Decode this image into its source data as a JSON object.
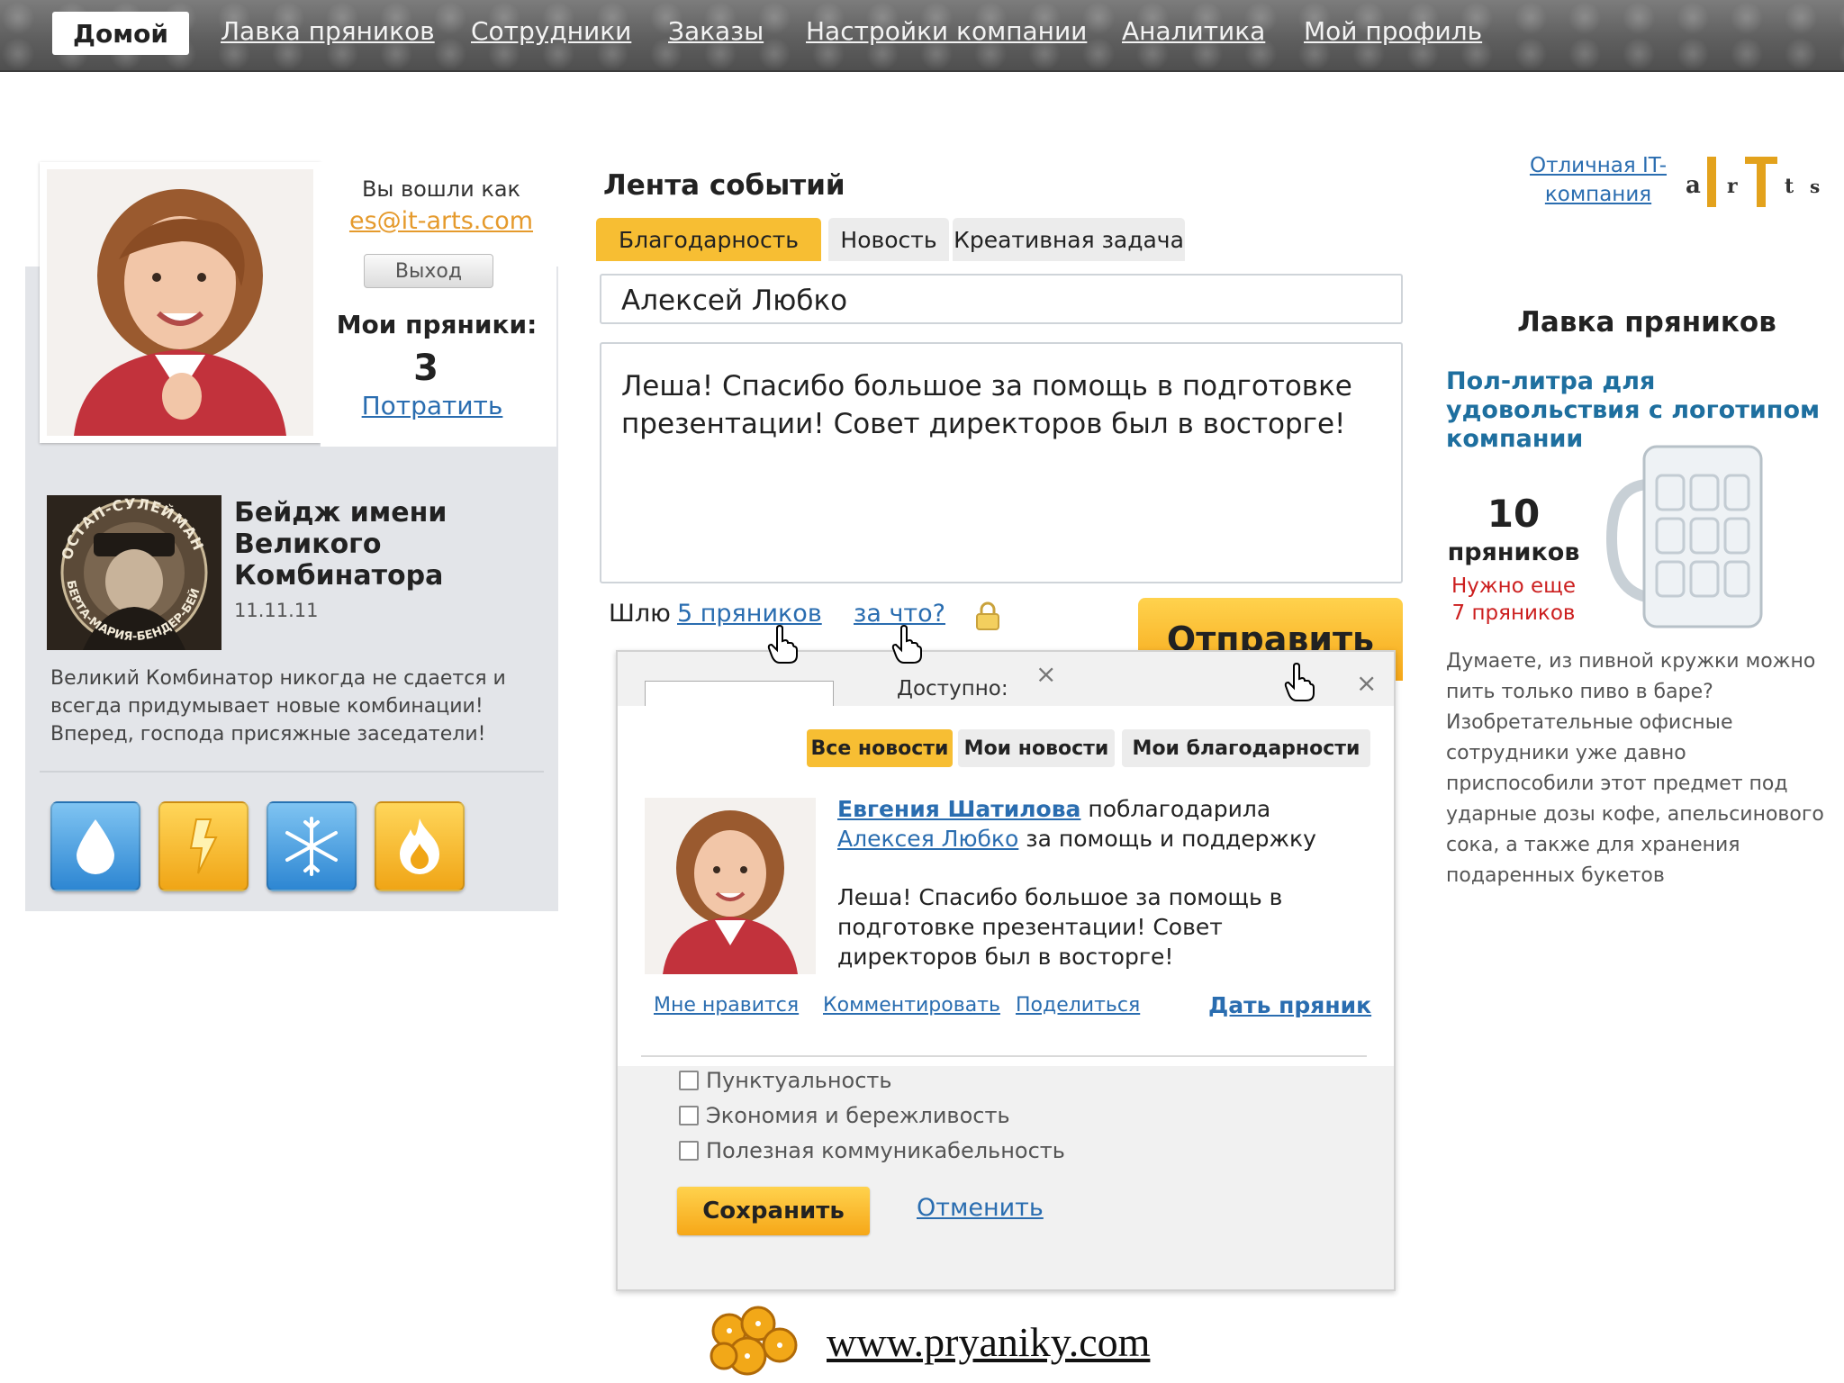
{
  "nav": {
    "home": "Домой",
    "items": [
      "Лавка пряников",
      "Сотрудники",
      "Заказы",
      "Настройки компании",
      "Аналитика",
      "Мой профиль"
    ]
  },
  "profile": {
    "logged_in_as": "Вы вошли как",
    "email": "es@it-arts.com",
    "logout": "Выход",
    "my_gingers_label": "Мои пряники:",
    "my_gingers_count": "3",
    "spend": "Потратить"
  },
  "badge": {
    "title": "Бейдж имени Великого Комбинатора",
    "date": "11.11.11",
    "description": "Великий Комбинатор никогда не сдается и всегда придумывает новые комбинации! Вперед, господа присяжные заседатели!",
    "image_text": [
      "ОСТАП-СУЛЕЙМАН",
      "БЕРТА-МАРИЯ-БЕНДЕР-БЕЙ"
    ]
  },
  "achievements": [
    "drop-icon",
    "lightning-icon",
    "snowflake-icon",
    "fire-icon"
  ],
  "feed": {
    "title": "Лента событий",
    "tabs": [
      "Благодарность",
      "Новость",
      "Креативная задача"
    ],
    "recipient": "Алексей Любко",
    "message": "Леша! Спасибо большое за помощь в подготовке презентации! Совет директоров был в восторге!",
    "send_label": "Шлю",
    "amount": "5 пряников",
    "why": "за что?",
    "send_button": "Отправить"
  },
  "popup": {
    "available_label": "Доступно:",
    "sub_tabs": [
      "Все новости",
      "Мои новости",
      "Мои благодарности"
    ],
    "post": {
      "author": "Евгения Шатилова",
      "action": "поблагодарила",
      "target": "Алексея Любко",
      "reason": "за помощь и поддержку",
      "body": "Леша! Спасибо большое за помощь в подготовке презентации! Совет директоров был в восторге!",
      "actions": [
        "Мне нравится",
        "Комментировать",
        "Поделиться"
      ],
      "give": "Дать пряник"
    },
    "checkboxes": [
      "Пунктуальность",
      "Экономия и бережливость",
      "Полезная коммуникабельность"
    ],
    "save": "Сохранить",
    "cancel": "Отменить"
  },
  "sidebar": {
    "company_link": "Отличная IT-компания",
    "shop_title": "Лавка пряников",
    "product_name": "Пол-литра для удовольствия с логотипом компании",
    "price": "10",
    "price_unit": "пряников",
    "need_more": "Нужно еще 7 пряников",
    "description": "Думаете, из пивной кружки можно пить только пиво в баре? Изобретательные офисные сотрудники уже давно приспособили этот предмет под ударные дозы кофе, апельсинового сока, а также для хранения подаренных букетов"
  },
  "footer": {
    "url": "www.pryaniky.com"
  },
  "colors": {
    "accent": "#f7be33",
    "link": "#2a6db0",
    "nav_bg": "#5f5f5f",
    "panel": "#e3e5e9"
  }
}
